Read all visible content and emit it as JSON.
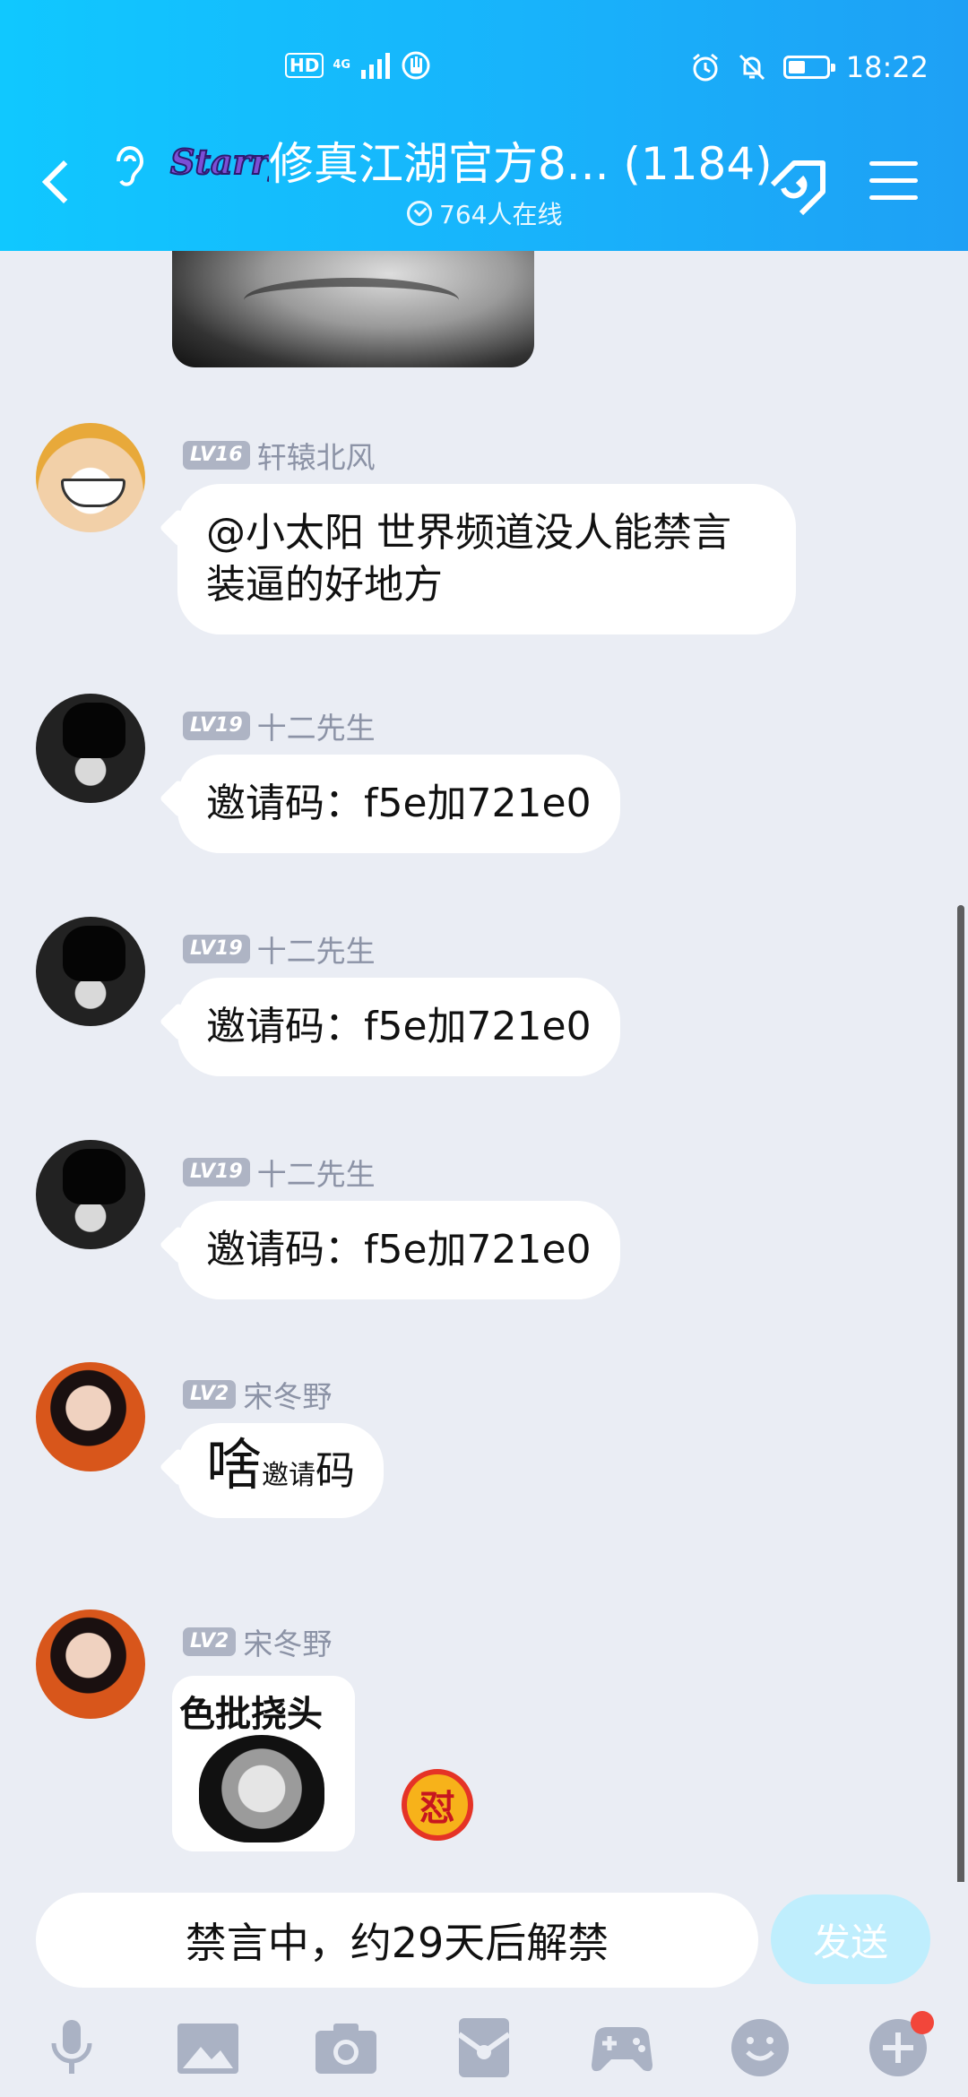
{
  "status_bar": {
    "hd": "HD",
    "network": "4G",
    "time": "18:22",
    "battery_level": 0.45
  },
  "header": {
    "title": "修真江湖官方8... (1184)",
    "logo_text": "Starry",
    "online_text": "764人在线"
  },
  "messages": [
    {
      "level": "LV16",
      "name": "轩辕北风",
      "avatar": "luffy",
      "text": "@小太阳 世界频道没人能禁言装逼的好地方"
    },
    {
      "level": "LV19",
      "name": "十二先生",
      "avatar": "dark",
      "text": "邀请码：f5e加721e0"
    },
    {
      "level": "LV19",
      "name": "十二先生",
      "avatar": "dark",
      "text": "邀请码：f5e加721e0"
    },
    {
      "level": "LV19",
      "name": "十二先生",
      "avatar": "dark",
      "text": "邀请码：f5e加721e0"
    },
    {
      "level": "LV2",
      "name": "宋冬野",
      "avatar": "orange",
      "text_big": "啥",
      "text_small": "邀请",
      "text_rest": "码"
    },
    {
      "level": "LV2",
      "name": "宋冬野",
      "avatar": "orange",
      "sticker_text": "色批挠头",
      "badge": "怼"
    }
  ],
  "input": {
    "muted_text": "禁言中，约29天后解禁",
    "send_label": "发送"
  },
  "toolbar_icons": [
    "microphone-icon",
    "image-icon",
    "camera-icon",
    "red-packet-icon",
    "gamepad-icon",
    "emoji-icon",
    "plus-icon"
  ],
  "colors": {
    "header_start": "#10c8ff",
    "header_end": "#1ea0f5",
    "chat_bg": "#eaedf4",
    "send_disabled": "#bfeefd",
    "level_badge": "#aeb4c4",
    "nick": "#8c93a6",
    "notification_dot": "#f2463a"
  }
}
